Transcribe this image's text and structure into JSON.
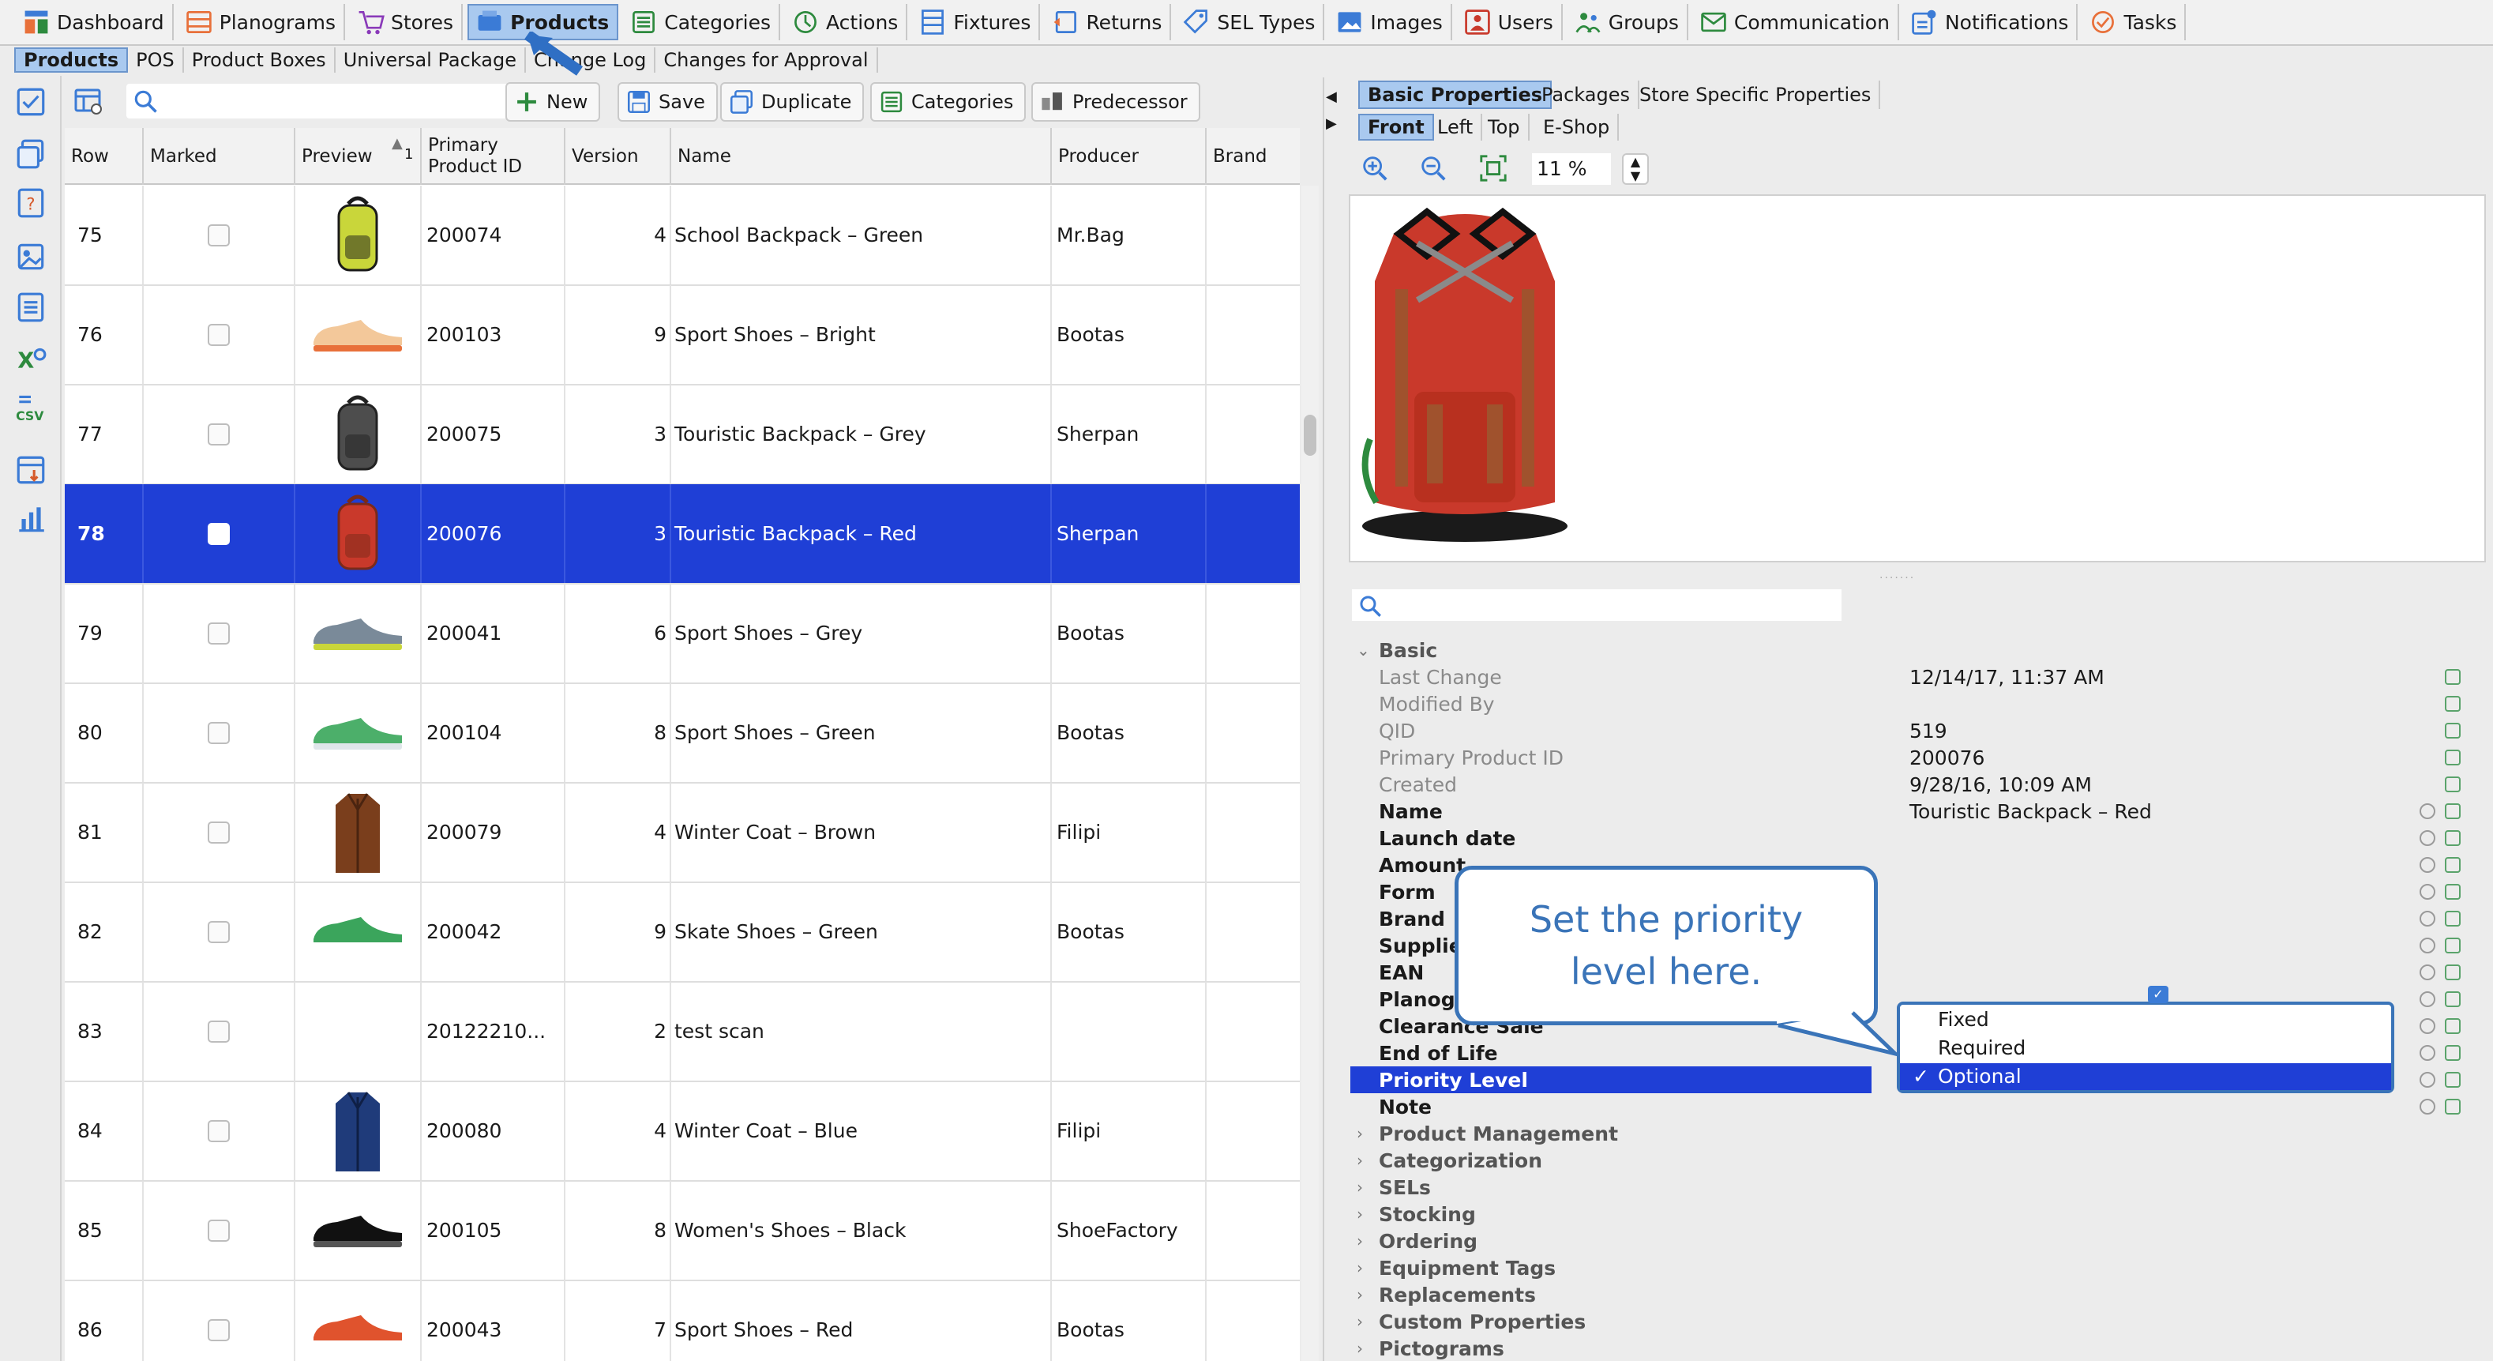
{
  "topmenu": [
    {
      "label": "Dashboard",
      "icon": "dashboard-icon"
    },
    {
      "label": "Planograms",
      "icon": "planogram-icon"
    },
    {
      "label": "Stores",
      "icon": "cart-icon"
    },
    {
      "label": "Products",
      "icon": "products-icon",
      "active": true
    },
    {
      "label": "Categories",
      "icon": "categories-icon"
    },
    {
      "label": "Actions",
      "icon": "actions-icon"
    },
    {
      "label": "Fixtures",
      "icon": "fixtures-icon"
    },
    {
      "label": "Returns",
      "icon": "returns-icon"
    },
    {
      "label": "SEL Types",
      "icon": "tag-icon"
    },
    {
      "label": "Images",
      "icon": "image-icon"
    },
    {
      "label": "Users",
      "icon": "users-icon"
    },
    {
      "label": "Groups",
      "icon": "groups-icon"
    },
    {
      "label": "Communication",
      "icon": "envelope-icon"
    },
    {
      "label": "Notifications",
      "icon": "notification-icon"
    },
    {
      "label": "Tasks",
      "icon": "tasks-icon"
    }
  ],
  "submenu": [
    {
      "label": "Products",
      "active": true
    },
    {
      "label": "POS"
    },
    {
      "label": "Product Boxes"
    },
    {
      "label": "Universal Package"
    },
    {
      "label": "Change Log"
    },
    {
      "label": "Changes for Approval"
    }
  ],
  "toolbar": {
    "search_placeholder": "",
    "new_label": "New",
    "save_label": "Save",
    "duplicate_label": "Duplicate",
    "categories_label": "Categories",
    "predecessor_label": "Predecessor"
  },
  "table": {
    "headers": {
      "row": "Row",
      "marked": "Marked",
      "preview": "Preview",
      "sort_index": "1",
      "primary_id": "Primary Product ID",
      "version": "Version",
      "name": "Name",
      "producer": "Producer",
      "brand": "Brand"
    },
    "rows": [
      {
        "row": "75",
        "id": "200074",
        "version": "4",
        "name": "School Backpack – Green",
        "producer": "Mr.Bag",
        "thumb": "backpack-green"
      },
      {
        "row": "76",
        "id": "200103",
        "version": "9",
        "name": "Sport Shoes – Bright",
        "producer": "Bootas",
        "thumb": "shoe-bright"
      },
      {
        "row": "77",
        "id": "200075",
        "version": "3",
        "name": "Touristic Backpack – Grey",
        "producer": "Sherpan",
        "thumb": "backpack-grey"
      },
      {
        "row": "78",
        "id": "200076",
        "version": "3",
        "name": "Touristic Backpack – Red",
        "producer": "Sherpan",
        "thumb": "backpack-red",
        "selected": true
      },
      {
        "row": "79",
        "id": "200041",
        "version": "6",
        "name": "Sport Shoes – Grey",
        "producer": "Bootas",
        "thumb": "shoe-grey"
      },
      {
        "row": "80",
        "id": "200104",
        "version": "8",
        "name": "Sport Shoes – Green",
        "producer": "Bootas",
        "thumb": "shoe-green"
      },
      {
        "row": "81",
        "id": "200079",
        "version": "4",
        "name": "Winter Coat – Brown",
        "producer": "Filipi",
        "thumb": "coat-brown"
      },
      {
        "row": "82",
        "id": "200042",
        "version": "9",
        "name": "Skate Shoes – Green",
        "producer": "Bootas",
        "thumb": "skate-green"
      },
      {
        "row": "83",
        "id": "20122210...",
        "version": "2",
        "name": "test scan",
        "producer": "",
        "thumb": ""
      },
      {
        "row": "84",
        "id": "200080",
        "version": "4",
        "name": "Winter Coat – Blue",
        "producer": "Filipi",
        "thumb": "coat-blue"
      },
      {
        "row": "85",
        "id": "200105",
        "version": "8",
        "name": "Women's Shoes – Black",
        "producer": "ShoeFactory",
        "thumb": "shoe-black"
      },
      {
        "row": "86",
        "id": "200043",
        "version": "7",
        "name": "Sport Shoes – Red",
        "producer": "Bootas",
        "thumb": "shoe-red"
      }
    ]
  },
  "right": {
    "tabs": [
      {
        "label": "Basic Properties",
        "active": true
      },
      {
        "label": "Packages"
      },
      {
        "label": "Store Specific Properties"
      }
    ],
    "view_tabs": [
      {
        "label": "Front",
        "active": true
      },
      {
        "label": "Left"
      },
      {
        "label": "Top"
      },
      {
        "label": "E-Shop"
      }
    ],
    "zoom": "11 %"
  },
  "properties": {
    "section_basic": "Basic",
    "rows": [
      {
        "label": "Last Change",
        "value": "12/14/17, 11:37 AM",
        "style": "gray"
      },
      {
        "label": "Modified By",
        "value": "",
        "style": "gray"
      },
      {
        "label": "QID",
        "value": "519",
        "style": "gray"
      },
      {
        "label": "Primary Product ID",
        "value": "200076",
        "style": "gray"
      },
      {
        "label": "Created",
        "value": "9/28/16, 10:09 AM",
        "style": "gray"
      },
      {
        "label": "Name",
        "value": "Touristic Backpack – Red",
        "style": "bold"
      },
      {
        "label": "Launch date",
        "value": "",
        "style": "bold"
      },
      {
        "label": "Amount",
        "value": "",
        "style": "bold"
      },
      {
        "label": "Form",
        "value": "",
        "style": "bold"
      },
      {
        "label": "Brand",
        "value": "",
        "style": "bold"
      },
      {
        "label": "Supplie",
        "value": "",
        "style": "bold"
      },
      {
        "label": "EAN",
        "value": "",
        "style": "bold"
      },
      {
        "label": "Planogr",
        "value": "",
        "style": "bold"
      },
      {
        "label": "Clearance Sale",
        "value": "",
        "style": "bold"
      },
      {
        "label": "End of Life",
        "value": "",
        "style": "bold"
      },
      {
        "label": "Priority Level",
        "value": "",
        "style": "selected"
      },
      {
        "label": "Note",
        "value": "",
        "style": "bold"
      }
    ],
    "groups": [
      "Product Management",
      "Categorization",
      "SELs",
      "Stocking",
      "Ordering",
      "Equipment Tags",
      "Replacements",
      "Custom Properties",
      "Pictograms"
    ]
  },
  "dropdown": {
    "options": [
      "Fixed",
      "Required",
      "Optional"
    ],
    "selected": "Optional",
    "check": "✓"
  },
  "callout": {
    "text": "Set the priority level here."
  },
  "colors": {
    "selection": "#1f3fd6",
    "active_tab": "#a9c9ef",
    "callout": "#3a74b8"
  }
}
